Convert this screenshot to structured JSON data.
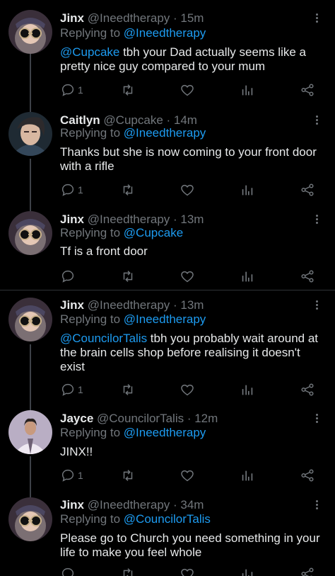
{
  "colors": {
    "background": "#000000",
    "name": "#e7e9ea",
    "muted": "#71767b",
    "link": "#1d9bf0",
    "thread_line": "#3d4147",
    "divider": "#2f3336"
  },
  "icons": {
    "reply": "reply-icon",
    "retweet": "retweet-icon",
    "like": "heart-icon",
    "views": "views-icon",
    "share": "share-icon",
    "more": "more-options-icon"
  },
  "tweets": [
    {
      "name": "Jinx",
      "handle": "@Ineedtherapy",
      "time": "· 15m",
      "replying_label": "Replying to",
      "replying_to": "@Ineedtherapy",
      "mention": "@Cupcake",
      "text": " tbh your Dad actually seems like a pretty nice guy compared to your mum",
      "reply_count": "1"
    },
    {
      "name": "Caitlyn",
      "handle": "@Cupcake",
      "time": "· 14m",
      "replying_label": "Replying to",
      "replying_to": "@Ineedtherapy",
      "mention": "",
      "text": "Thanks but she is now coming to your front door with a rifle",
      "reply_count": "1"
    },
    {
      "name": "Jinx",
      "handle": "@Ineedtherapy",
      "time": "· 13m",
      "replying_label": "Replying to",
      "replying_to": "@Cupcake",
      "mention": "",
      "text": "Tf is a front door",
      "reply_count": ""
    },
    {
      "name": "Jinx",
      "handle": "@Ineedtherapy",
      "time": "· 13m",
      "replying_label": "Replying to",
      "replying_to": "@Ineedtherapy",
      "mention": "@CouncilorTalis",
      "text": " tbh you probably wait around at the brain cells shop before realising it doesn't exist",
      "reply_count": "1"
    },
    {
      "name": "Jayce",
      "handle": "@CouncilorTalis",
      "time": "· 12m",
      "replying_label": "Replying to",
      "replying_to": "@Ineedtherapy",
      "mention": "",
      "text": "JINX!!",
      "reply_count": "1"
    },
    {
      "name": "Jinx",
      "handle": "@Ineedtherapy",
      "time": "· 34m",
      "replying_label": "Replying to",
      "replying_to": "@CouncilorTalis",
      "mention": "",
      "text": "Please go to Church you need something in your life to make you feel whole",
      "reply_count": ""
    }
  ]
}
